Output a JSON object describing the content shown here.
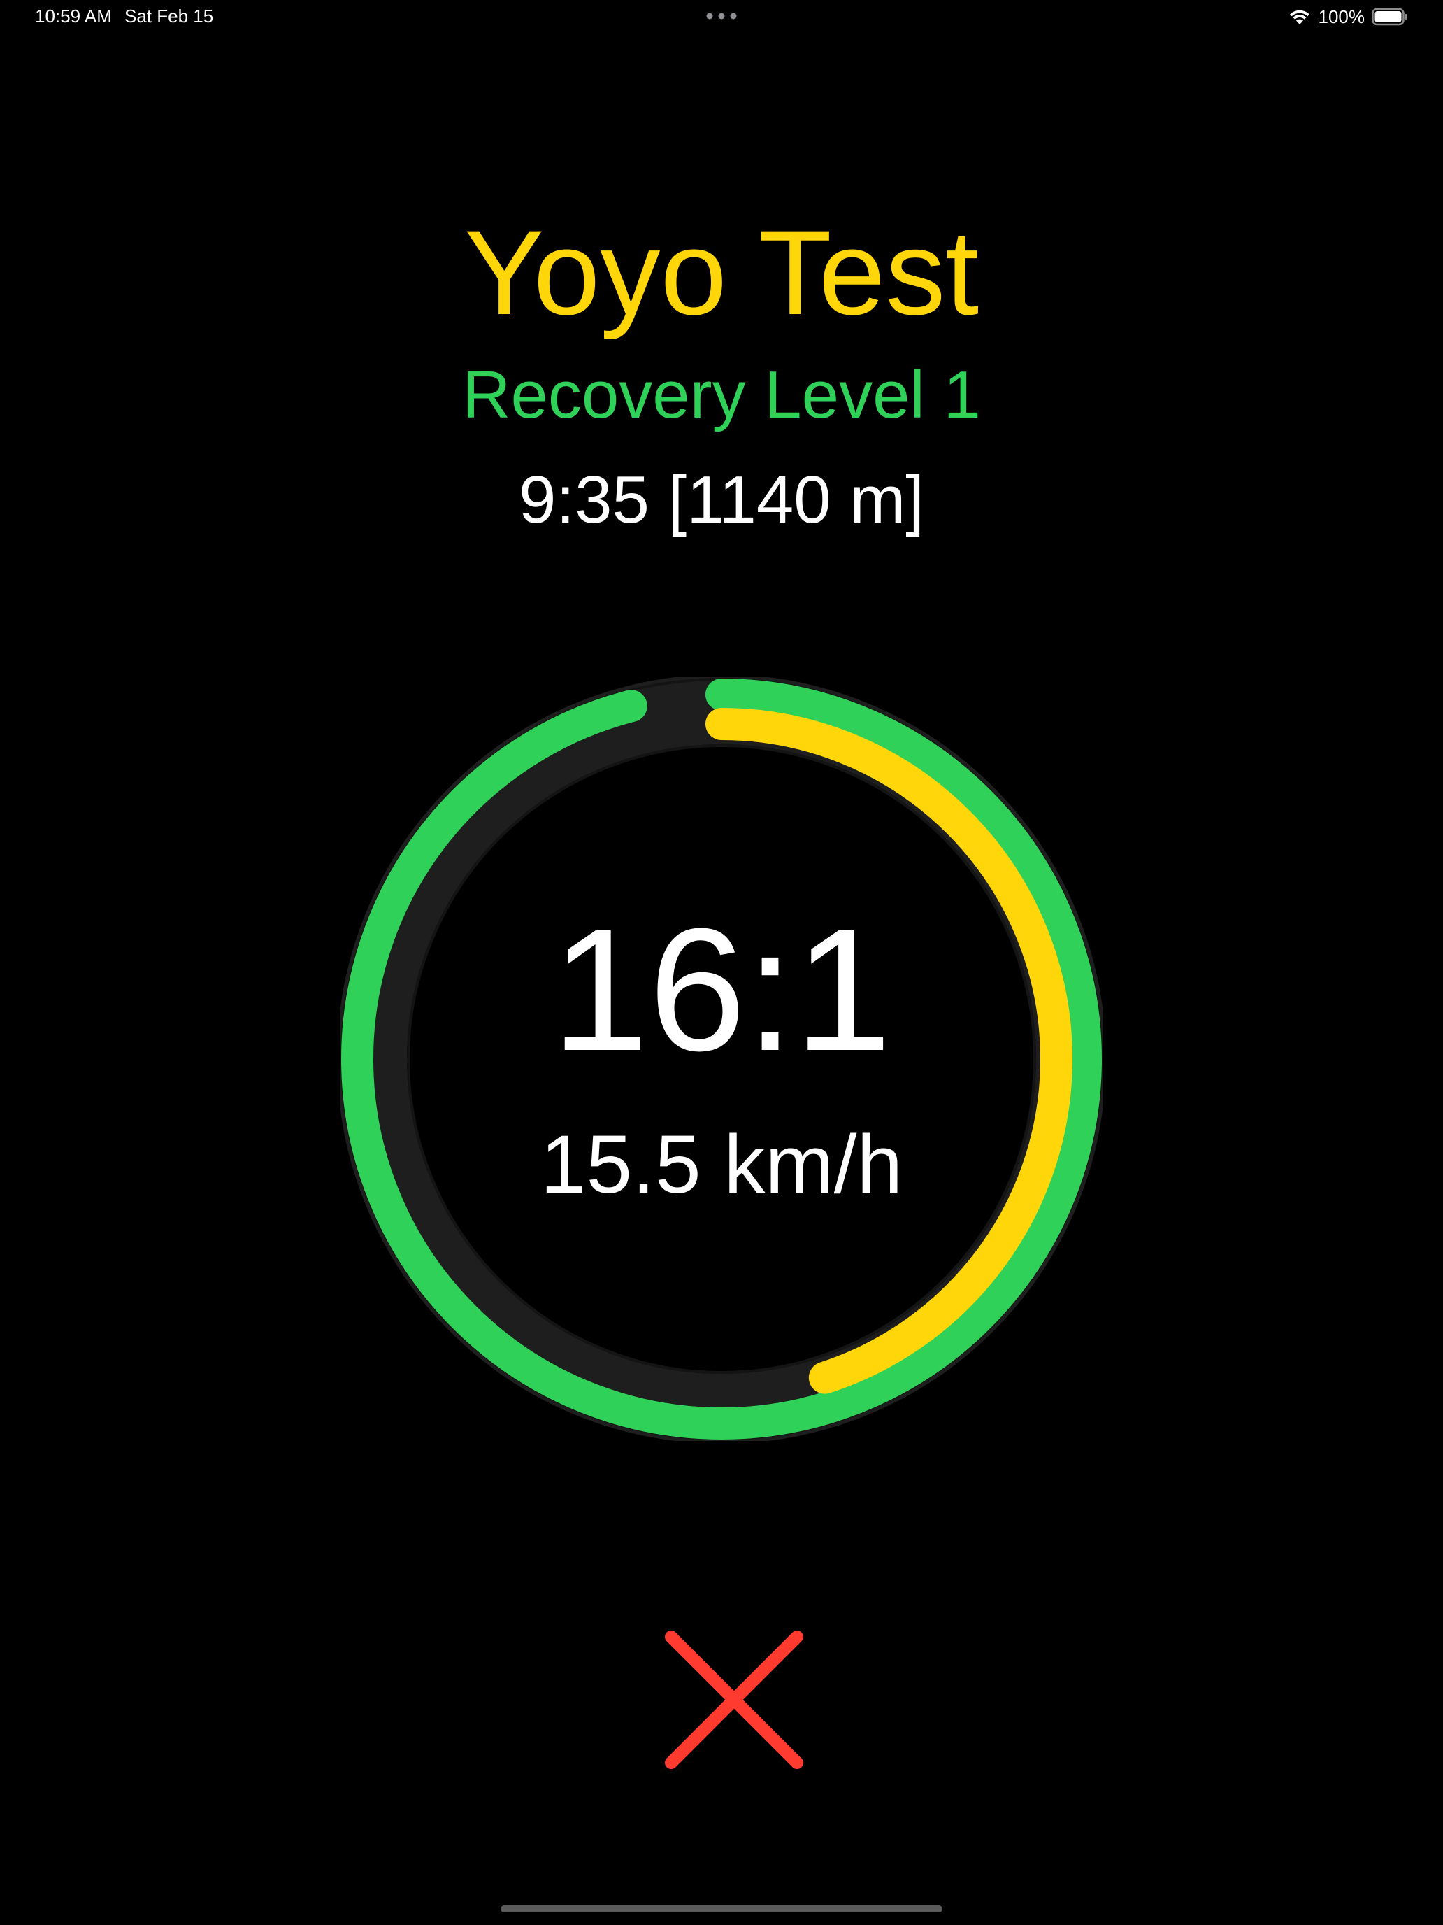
{
  "status_bar": {
    "time": "10:59 AM",
    "date": "Sat Feb 15",
    "battery_text": "100%",
    "icons": [
      "wifi-icon",
      "battery-icon",
      "multitask-dots-icon"
    ]
  },
  "header": {
    "title": "Yoyo Test",
    "subtitle": "Recovery Level 1",
    "elapsed": "9:35 [1140 m]"
  },
  "ring": {
    "level": "16:1",
    "speed": "15.5 km/h",
    "outer_progress": 0.96,
    "inner_progress": 0.45
  },
  "controls": {
    "stop_icon": "close-icon"
  },
  "colors": {
    "background": "#000000",
    "accent_yellow": "#ffd60a",
    "accent_green": "#30d158",
    "ring_track": "#1e1e1e",
    "stop_red": "#ff3b30",
    "text": "#ffffff"
  }
}
